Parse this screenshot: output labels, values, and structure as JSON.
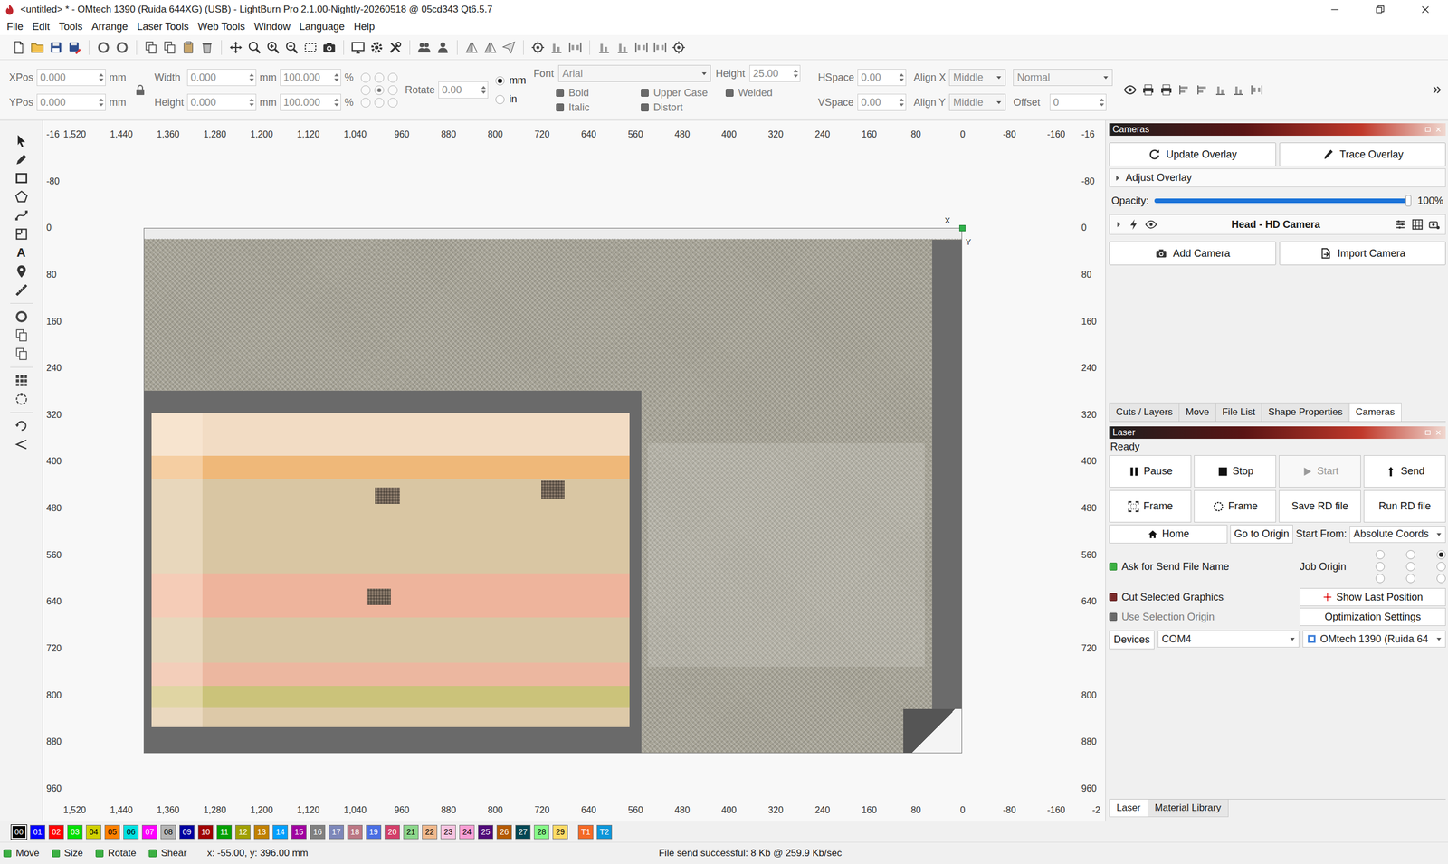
{
  "window": {
    "title": "<untitled> * - OMtech 1390 (Ruida 644XG) (USB) - LightBurn Pro 2.1.00-Nightly-20260518 @ 05cd343 Qt6.5.7"
  },
  "menu": [
    "File",
    "Edit",
    "Tools",
    "Arrange",
    "Laser Tools",
    "Web Tools",
    "Window",
    "Language",
    "Help"
  ],
  "properties": {
    "disabled": true,
    "position": [
      {
        "label": "XPos",
        "value": "0.000",
        "unit": "mm"
      },
      {
        "label": "YPos",
        "value": "0.000",
        "unit": "mm"
      }
    ],
    "size": [
      {
        "label": "Width",
        "value": "0.000",
        "unit": "mm",
        "percent": "100.000",
        "percent_unit": "%"
      },
      {
        "label": "Height",
        "value": "0.000",
        "unit": "mm",
        "percent": "100.000",
        "percent_unit": "%"
      }
    ],
    "anchor": [
      false,
      false,
      false,
      false,
      true,
      false,
      false,
      false,
      false
    ],
    "rotate": {
      "label": "Rotate",
      "value": "0.00"
    },
    "units": [
      {
        "label": "mm",
        "selected": true
      },
      {
        "label": "in",
        "selected": false
      }
    ],
    "font": {
      "label": "Font",
      "value": "Arial"
    },
    "text_height": {
      "label": "Height",
      "value": "25.00"
    },
    "toggles": [
      {
        "label": "Bold",
        "checked": false
      },
      {
        "label": "Italic",
        "checked": false
      },
      {
        "label": "Upper Case",
        "checked": false
      },
      {
        "label": "Distort",
        "checked": false
      },
      {
        "label": "Welded",
        "checked": false
      }
    ],
    "spacing": [
      {
        "label": "HSpace",
        "value": "0.00"
      },
      {
        "label": "VSpace",
        "value": "0.00"
      }
    ],
    "align": [
      {
        "label": "Align X",
        "value": "Middle"
      },
      {
        "label": "Align Y",
        "value": "Middle"
      }
    ],
    "mode": {
      "value": "Normal"
    },
    "offset": {
      "label": "Offset",
      "value": "0"
    }
  },
  "left_toolbar": {
    "text_tool_glyph": "A"
  },
  "canvas": {
    "top_ruler": [
      "1,520",
      "1,440",
      "1,360",
      "1,280",
      "1,200",
      "1,120",
      "1,040",
      "960",
      "880",
      "800",
      "720",
      "640",
      "560",
      "480",
      "400",
      "320",
      "240",
      "160",
      "80",
      "0",
      "-80",
      "-160"
    ],
    "bottom_ruler": [
      "1,520",
      "1,440",
      "1,360",
      "1,280",
      "1,200",
      "1,120",
      "1,040",
      "960",
      "880",
      "800",
      "720",
      "640",
      "560",
      "480",
      "400",
      "320",
      "240",
      "160",
      "80",
      "0",
      "-80",
      "-160",
      "-2"
    ],
    "left_ruler": [
      "-16",
      "-80",
      "0",
      "80",
      "160",
      "240",
      "320",
      "400",
      "480",
      "560",
      "640",
      "720",
      "800",
      "880",
      "960"
    ],
    "right_ruler": [
      "-16",
      "-80",
      "0",
      "80",
      "160",
      "240",
      "320",
      "400",
      "480",
      "560",
      "640",
      "720",
      "800",
      "880",
      "960"
    ],
    "origin": {
      "x_label": "X",
      "y_label": "Y"
    }
  },
  "cameras": {
    "title": "Cameras",
    "buttons": [
      "Update Overlay",
      "Trace Overlay"
    ],
    "adjust": {
      "label": "Adjust Overlay",
      "expanded": false
    },
    "opacity": {
      "label": "Opacity:",
      "level": 1.0,
      "reading": "100%"
    },
    "camera": {
      "name": "Head - HD Camera",
      "expanded": false,
      "visible": true
    },
    "actions": [
      "Add Camera",
      "Import Camera"
    ]
  },
  "dock_tabs": [
    {
      "label": "Cuts / Layers",
      "selected": false
    },
    {
      "label": "Move",
      "selected": false
    },
    {
      "label": "File List",
      "selected": false
    },
    {
      "label": "Shape Properties",
      "selected": false
    },
    {
      "label": "Cameras",
      "selected": true
    }
  ],
  "laser": {
    "title": "Laser",
    "status": "Ready",
    "buttons": [
      {
        "label": "Pause",
        "disabled": false
      },
      {
        "label": "Stop",
        "disabled": false
      },
      {
        "label": "Start",
        "disabled": true
      },
      {
        "label": "Send",
        "disabled": false
      },
      {
        "label": "Frame",
        "disabled": false
      },
      {
        "label": "Frame",
        "disabled": false
      },
      {
        "label": "Save RD file",
        "disabled": false
      },
      {
        "label": "Run RD file",
        "disabled": false
      }
    ],
    "home": "Home",
    "go_to_origin": "Go to Origin",
    "start_from": {
      "label": "Start From:",
      "value": "Absolute Coords"
    },
    "options": [
      {
        "label": "Ask for Send File Name",
        "checked": true,
        "disabled": false
      },
      {
        "label": "Cut Selected Graphics",
        "checked": false,
        "disabled": false
      },
      {
        "label": "Use Selection Origin",
        "checked": false,
        "disabled": true
      }
    ],
    "job_origin": {
      "label": "Job Origin",
      "points": [
        false,
        false,
        true,
        false,
        false,
        false,
        false,
        false,
        false
      ]
    },
    "side_buttons": [
      "Show Last Position",
      "Optimization Settings"
    ],
    "devices": "Devices",
    "port": "COM4",
    "machine": "OMtech 1390 (Ruida 64"
  },
  "bottom_tabs": [
    {
      "label": "Laser",
      "selected": true
    },
    {
      "label": "Material Library",
      "selected": false
    }
  ],
  "palette": [
    {
      "label": "00",
      "color": "#000000",
      "selected": true,
      "kind": "layer"
    },
    {
      "label": "01",
      "color": "#0000ff",
      "selected": false,
      "kind": "layer"
    },
    {
      "label": "02",
      "color": "#ff0000",
      "selected": false,
      "kind": "layer"
    },
    {
      "label": "03",
      "color": "#00e000",
      "selected": false,
      "kind": "layer"
    },
    {
      "label": "04",
      "color": "#d0d000",
      "selected": false,
      "kind": "layer"
    },
    {
      "label": "05",
      "color": "#ff8000",
      "selected": false,
      "kind": "layer"
    },
    {
      "label": "06",
      "color": "#00e0e0",
      "selected": false,
      "kind": "layer"
    },
    {
      "label": "07",
      "color": "#ff00ff",
      "selected": false,
      "kind": "layer"
    },
    {
      "label": "08",
      "color": "#b4b4b4",
      "selected": false,
      "kind": "layer"
    },
    {
      "label": "09",
      "color": "#0000a0",
      "selected": false,
      "kind": "layer"
    },
    {
      "label": "10",
      "color": "#a00000",
      "selected": false,
      "kind": "layer"
    },
    {
      "label": "11",
      "color": "#00a000",
      "selected": false,
      "kind": "layer"
    },
    {
      "label": "12",
      "color": "#a0a000",
      "selected": false,
      "kind": "layer"
    },
    {
      "label": "13",
      "color": "#c08000",
      "selected": false,
      "kind": "layer"
    },
    {
      "label": "14",
      "color": "#00a0ff",
      "selected": false,
      "kind": "layer"
    },
    {
      "label": "15",
      "color": "#a000a0",
      "selected": false,
      "kind": "layer"
    },
    {
      "label": "16",
      "color": "#808080",
      "selected": false,
      "kind": "layer"
    },
    {
      "label": "17",
      "color": "#7d87b9",
      "selected": false,
      "kind": "layer"
    },
    {
      "label": "18",
      "color": "#bb7784",
      "selected": false,
      "kind": "layer"
    },
    {
      "label": "19",
      "color": "#4a6fe3",
      "selected": false,
      "kind": "layer"
    },
    {
      "label": "20",
      "color": "#d33f6a",
      "selected": false,
      "kind": "layer"
    },
    {
      "label": "21",
      "color": "#8cd78c",
      "selected": false,
      "kind": "layer"
    },
    {
      "label": "22",
      "color": "#f0b98d",
      "selected": false,
      "kind": "layer"
    },
    {
      "label": "23",
      "color": "#f6c4e1",
      "selected": false,
      "kind": "layer"
    },
    {
      "label": "24",
      "color": "#fa9ed4",
      "selected": false,
      "kind": "layer"
    },
    {
      "label": "25",
      "color": "#500a78",
      "selected": false,
      "kind": "layer"
    },
    {
      "label": "26",
      "color": "#b45a00",
      "selected": false,
      "kind": "layer"
    },
    {
      "label": "27",
      "color": "#004754",
      "selected": false,
      "kind": "layer"
    },
    {
      "label": "28",
      "color": "#86fa88",
      "selected": false,
      "kind": "layer"
    },
    {
      "label": "29",
      "color": "#ffdb66",
      "selected": false,
      "kind": "layer"
    },
    {
      "label": "T1",
      "color": "#f36926",
      "selected": false,
      "kind": "tool"
    },
    {
      "label": "T2",
      "color": "#0c96d9",
      "selected": false,
      "kind": "tool"
    }
  ],
  "status_bar": {
    "toggles": [
      {
        "label": "Move",
        "checked": true
      },
      {
        "label": "Size",
        "checked": true
      },
      {
        "label": "Rotate",
        "checked": true
      },
      {
        "label": "Shear",
        "checked": true
      }
    ],
    "coords": "x: -55.00, y: 396.00 mm",
    "message": "File send successful: 8 Kb @ 259.9 Kb/sec"
  }
}
